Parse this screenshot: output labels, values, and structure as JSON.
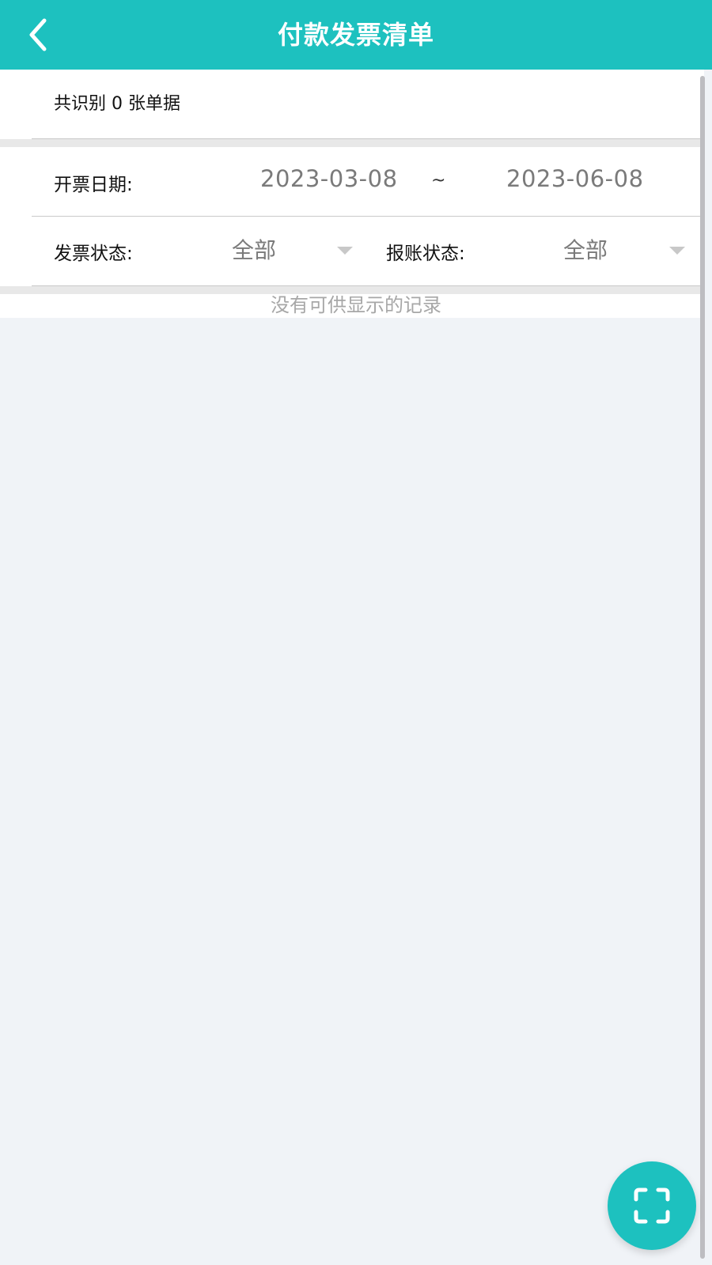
{
  "header": {
    "title": "付款发票清单",
    "back_icon": "chevron-left-icon"
  },
  "summary": {
    "count_text": "共识别 0 张单据"
  },
  "filters": {
    "date_label": "开票日期:",
    "date_from": "2023-03-08",
    "date_separator": "~",
    "date_to": "2023-06-08",
    "invoice_status_label": "发票状态:",
    "invoice_status_value": "全部",
    "reimburse_status_label": "报账状态:",
    "reimburse_status_value": "全部"
  },
  "list": {
    "empty_text": "没有可供显示的记录"
  },
  "fab": {
    "icon": "scan-icon"
  },
  "colors": {
    "accent": "#1dc1bf",
    "background": "#f0f3f7"
  }
}
